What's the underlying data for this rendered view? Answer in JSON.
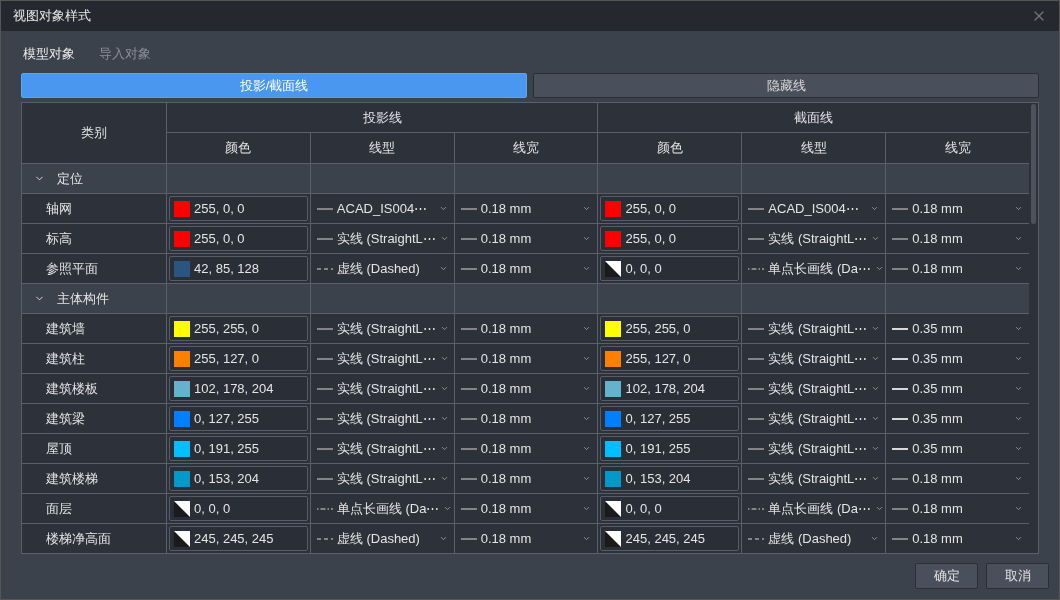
{
  "window": {
    "title": "视图对象样式"
  },
  "tabs": [
    {
      "label": "模型对象",
      "selected": true
    },
    {
      "label": "导入对象",
      "selected": false
    }
  ],
  "modes": [
    {
      "label": "投影/截面线",
      "selected": true
    },
    {
      "label": "隐藏线",
      "selected": false
    }
  ],
  "table": {
    "category_header": "类别",
    "groups": [
      {
        "label": "投影线",
        "columns": [
          "颜色",
          "线型",
          "线宽"
        ]
      },
      {
        "label": "截面线",
        "columns": [
          "颜色",
          "线型",
          "线宽"
        ]
      }
    ],
    "sections": [
      {
        "label": "定位",
        "expanded": true,
        "children": [
          {
            "name": "轴网",
            "projection": {
              "color": {
                "kind": "solid",
                "color": "#ff0000",
                "value": "255, 0, 0"
              },
              "line_type": {
                "kind": "solid",
                "label": "ACAD_IS004⋯"
              },
              "line_weight": {
                "kind": "thin",
                "label": "0.18 mm"
              }
            },
            "cut": {
              "color": {
                "kind": "solid",
                "color": "#ff0000",
                "value": "255, 0, 0"
              },
              "line_type": {
                "kind": "solid",
                "label": "ACAD_IS004⋯"
              },
              "line_weight": {
                "kind": "thin",
                "label": "0.18 mm"
              }
            }
          },
          {
            "name": "标高",
            "projection": {
              "color": {
                "kind": "solid",
                "color": "#ff0000",
                "value": "255, 0, 0"
              },
              "line_type": {
                "kind": "solid",
                "label": "实线 (StraightL⋯"
              },
              "line_weight": {
                "kind": "thin",
                "label": "0.18 mm"
              }
            },
            "cut": {
              "color": {
                "kind": "solid",
                "color": "#ff0000",
                "value": "255, 0, 0"
              },
              "line_type": {
                "kind": "solid",
                "label": "实线 (StraightL⋯"
              },
              "line_weight": {
                "kind": "thin",
                "label": "0.18 mm"
              }
            }
          },
          {
            "name": "参照平面",
            "projection": {
              "color": {
                "kind": "solid",
                "color": "#2a5580",
                "value": "42, 85, 128"
              },
              "line_type": {
                "kind": "dashed",
                "label": "虚线 (Dashed)"
              },
              "line_weight": {
                "kind": "thin",
                "label": "0.18 mm"
              }
            },
            "cut": {
              "color": {
                "kind": "split",
                "value": "0, 0, 0"
              },
              "line_type": {
                "kind": "dashdot",
                "label": "单点长画线 (Da⋯"
              },
              "line_weight": {
                "kind": "thin",
                "label": "0.18 mm"
              }
            }
          }
        ]
      },
      {
        "label": "主体构件",
        "expanded": true,
        "children": [
          {
            "name": "建筑墙",
            "projection": {
              "color": {
                "kind": "solid",
                "color": "#ffff00",
                "value": "255, 255, 0"
              },
              "line_type": {
                "kind": "solid",
                "label": "实线 (StraightL⋯"
              },
              "line_weight": {
                "kind": "thin",
                "label": "0.18 mm"
              }
            },
            "cut": {
              "color": {
                "kind": "solid",
                "color": "#ffff00",
                "value": "255, 255, 0"
              },
              "line_type": {
                "kind": "solid",
                "label": "实线 (StraightL⋯"
              },
              "line_weight": {
                "kind": "thick",
                "label": "0.35 mm"
              }
            }
          },
          {
            "name": "建筑柱",
            "projection": {
              "color": {
                "kind": "solid",
                "color": "#ff7f00",
                "value": "255, 127, 0"
              },
              "line_type": {
                "kind": "solid",
                "label": "实线 (StraightL⋯"
              },
              "line_weight": {
                "kind": "thin",
                "label": "0.18 mm"
              }
            },
            "cut": {
              "color": {
                "kind": "solid",
                "color": "#ff7f00",
                "value": "255, 127, 0"
              },
              "line_type": {
                "kind": "solid",
                "label": "实线 (StraightL⋯"
              },
              "line_weight": {
                "kind": "thick",
                "label": "0.35 mm"
              }
            }
          },
          {
            "name": "建筑楼板",
            "projection": {
              "color": {
                "kind": "solid",
                "color": "#66b2cc",
                "value": "102, 178, 204"
              },
              "line_type": {
                "kind": "solid",
                "label": "实线 (StraightL⋯"
              },
              "line_weight": {
                "kind": "thin",
                "label": "0.18 mm"
              }
            },
            "cut": {
              "color": {
                "kind": "solid",
                "color": "#66b2cc",
                "value": "102, 178, 204"
              },
              "line_type": {
                "kind": "solid",
                "label": "实线 (StraightL⋯"
              },
              "line_weight": {
                "kind": "thick",
                "label": "0.35 mm"
              }
            }
          },
          {
            "name": "建筑梁",
            "projection": {
              "color": {
                "kind": "solid",
                "color": "#007fff",
                "value": "0, 127, 255"
              },
              "line_type": {
                "kind": "solid",
                "label": "实线 (StraightL⋯"
              },
              "line_weight": {
                "kind": "thin",
                "label": "0.18 mm"
              }
            },
            "cut": {
              "color": {
                "kind": "solid",
                "color": "#007fff",
                "value": "0, 127, 255"
              },
              "line_type": {
                "kind": "solid",
                "label": "实线 (StraightL⋯"
              },
              "line_weight": {
                "kind": "thick",
                "label": "0.35 mm"
              }
            }
          },
          {
            "name": "屋顶",
            "projection": {
              "color": {
                "kind": "solid",
                "color": "#00bfff",
                "value": "0, 191, 255"
              },
              "line_type": {
                "kind": "solid",
                "label": "实线 (StraightL⋯"
              },
              "line_weight": {
                "kind": "thin",
                "label": "0.18 mm"
              }
            },
            "cut": {
              "color": {
                "kind": "solid",
                "color": "#00bfff",
                "value": "0, 191, 255"
              },
              "line_type": {
                "kind": "solid",
                "label": "实线 (StraightL⋯"
              },
              "line_weight": {
                "kind": "thick",
                "label": "0.35 mm"
              }
            }
          },
          {
            "name": "建筑楼梯",
            "projection": {
              "color": {
                "kind": "solid",
                "color": "#0099cc",
                "value": "0, 153, 204"
              },
              "line_type": {
                "kind": "solid",
                "label": "实线 (StraightL⋯"
              },
              "line_weight": {
                "kind": "thin",
                "label": "0.18 mm"
              }
            },
            "cut": {
              "color": {
                "kind": "solid",
                "color": "#0099cc",
                "value": "0, 153, 204"
              },
              "line_type": {
                "kind": "solid",
                "label": "实线 (StraightL⋯"
              },
              "line_weight": {
                "kind": "thin",
                "label": "0.18 mm"
              }
            }
          },
          {
            "name": "面层",
            "projection": {
              "color": {
                "kind": "split",
                "value": "0, 0, 0"
              },
              "line_type": {
                "kind": "dashdot",
                "label": "单点长画线 (Da⋯"
              },
              "line_weight": {
                "kind": "thin",
                "label": "0.18 mm"
              }
            },
            "cut": {
              "color": {
                "kind": "split",
                "value": "0, 0, 0"
              },
              "line_type": {
                "kind": "dashdot",
                "label": "单点长画线 (Da⋯"
              },
              "line_weight": {
                "kind": "thin",
                "label": "0.18 mm"
              }
            }
          },
          {
            "name": "楼梯净高面",
            "projection": {
              "color": {
                "kind": "split",
                "value": "245, 245, 245"
              },
              "line_type": {
                "kind": "dashed",
                "label": "虚线 (Dashed)"
              },
              "line_weight": {
                "kind": "thin",
                "label": "0.18 mm"
              }
            },
            "cut": {
              "color": {
                "kind": "split",
                "value": "245, 245, 245"
              },
              "line_type": {
                "kind": "dashed",
                "label": "虚线 (Dashed)"
              },
              "line_weight": {
                "kind": "thin",
                "label": "0.18 mm"
              }
            }
          }
        ]
      }
    ]
  },
  "buttons": [
    "确定",
    "取消"
  ]
}
